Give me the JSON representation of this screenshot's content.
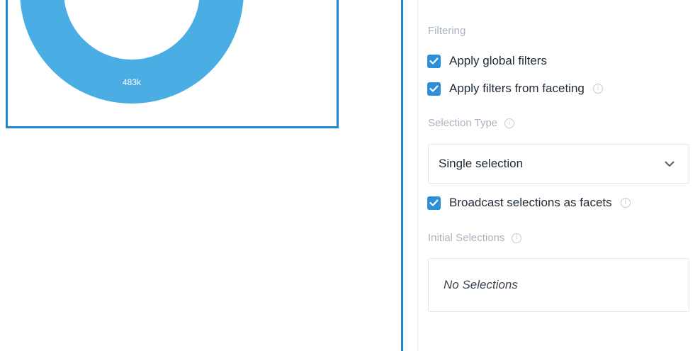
{
  "chart": {
    "value_label": "483k",
    "colors": {
      "ring": "#4aaee4",
      "frame": "#1b8ad3"
    }
  },
  "panel": {
    "filtering_label": "Filtering",
    "apply_global_filters": {
      "label": "Apply global filters",
      "checked": true
    },
    "apply_faceting_filters": {
      "label": "Apply filters from faceting",
      "checked": true
    },
    "selection_type_label": "Selection Type",
    "selection_type_value": "Single selection",
    "broadcast": {
      "label": "Broadcast selections as facets",
      "checked": true
    },
    "initial_selections_label": "Initial Selections",
    "initial_selections_value": "No Selections",
    "icons": {
      "info": "info-icon",
      "chevron": "chevron-down-icon",
      "check": "checkmark-icon"
    },
    "colors": {
      "accent": "#2b8fd9",
      "muted_label": "#aab4bf"
    }
  }
}
